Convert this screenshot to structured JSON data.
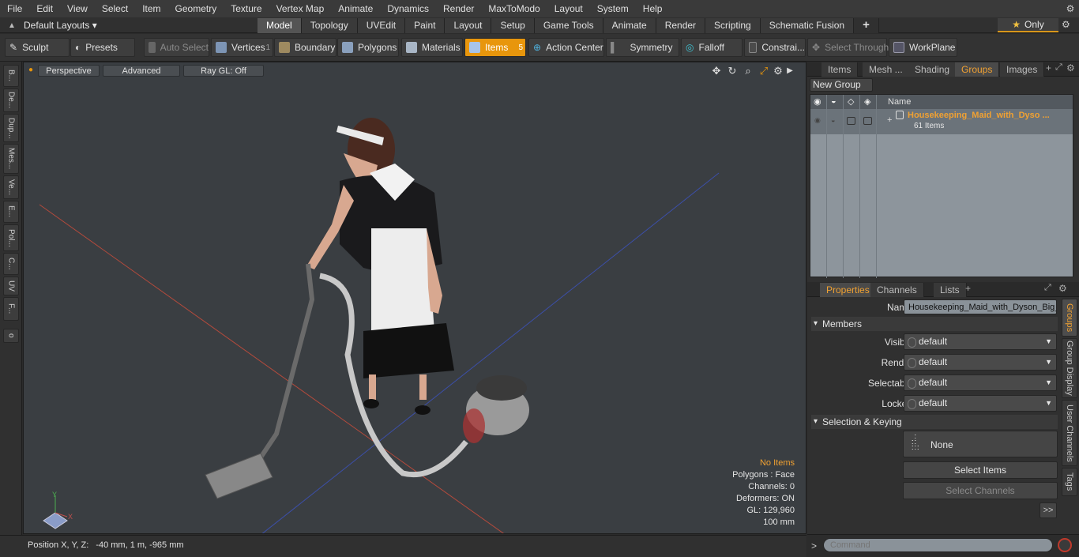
{
  "menubar": {
    "items": [
      "File",
      "Edit",
      "View",
      "Select",
      "Item",
      "Geometry",
      "Texture",
      "Vertex Map",
      "Animate",
      "Dynamics",
      "Render",
      "MaxToModo",
      "Layout",
      "System",
      "Help"
    ]
  },
  "tabbar": {
    "layout_label": "Default Layouts ▾",
    "tabs": [
      "Model",
      "Topology",
      "UVEdit",
      "Paint",
      "Layout",
      "Setup",
      "Game Tools",
      "Animate",
      "Render",
      "Scripting",
      "Schematic Fusion"
    ],
    "active_tab": "Model",
    "add_symbol": "+",
    "only_label": "Only"
  },
  "toolbar": {
    "sculpt": "Sculpt",
    "presets": "Presets",
    "auto_select": "Auto Select",
    "vertices": "Vertices",
    "vertices_count": "1",
    "boundary": "Boundary",
    "polygons": "Polygons",
    "materials": "Materials",
    "items": "Items",
    "items_count": "5",
    "action_center": "Action Center",
    "symmetry": "Symmetry",
    "falloff": "Falloff",
    "constraints": "Constrai...",
    "select_through": "Select Through",
    "workplane": "WorkPlane"
  },
  "left_tabs": [
    "B...",
    "De...",
    "Dup...",
    "Mes...",
    "Ve...",
    "E...",
    "Pol...",
    "C...",
    "UV",
    "F..."
  ],
  "viewport": {
    "view_mode": "Perspective",
    "advanced": "Advanced",
    "ray_gl": "Ray GL: Off",
    "info": {
      "items": "No Items",
      "polygons": "Polygons : Face",
      "channels": "Channels: 0",
      "deformers": "Deformers: ON",
      "gl": "GL: 129,960",
      "scale": "100 mm"
    },
    "axis_y": "Y",
    "axis_x": "X"
  },
  "statusbar": {
    "position_label": "Position X, Y, Z:",
    "position_value": "-40 mm, 1 m, -965 mm"
  },
  "groups_panel": {
    "tabs": [
      "Items",
      "Mesh ...",
      "Shading",
      "Groups",
      "Images"
    ],
    "active_tab": "Groups",
    "new_group": "New Group",
    "name_header": "Name",
    "group_name": "Housekeeping_Maid_with_Dyso ...",
    "group_count": "61 Items"
  },
  "properties_panel": {
    "tabs": [
      "Properties",
      "Channels",
      "Lists"
    ],
    "active_tab": "Properties",
    "name_label": "Name",
    "name_value": "Housekeeping_Maid_with_Dyson_Big_",
    "members_section": "Members",
    "visible_label": "Visible",
    "visible_value": "default",
    "render_label": "Render",
    "render_value": "default",
    "selectable_label": "Selectable",
    "selectable_value": "default",
    "locked_label": "Locked",
    "locked_value": "default",
    "selection_section": "Selection & Keying",
    "none_label": "None",
    "select_items": "Select Items",
    "select_channels": "Select Channels",
    "more": ">>",
    "side_tabs": [
      "Groups",
      "Group Display",
      "User Channels",
      "Tags"
    ]
  },
  "command": {
    "prompt": ">",
    "placeholder": "Command"
  },
  "colors": {
    "accent": "#e8960c",
    "active_tab_text": "#f0a132",
    "viewport_bg": "#3a3e42"
  }
}
